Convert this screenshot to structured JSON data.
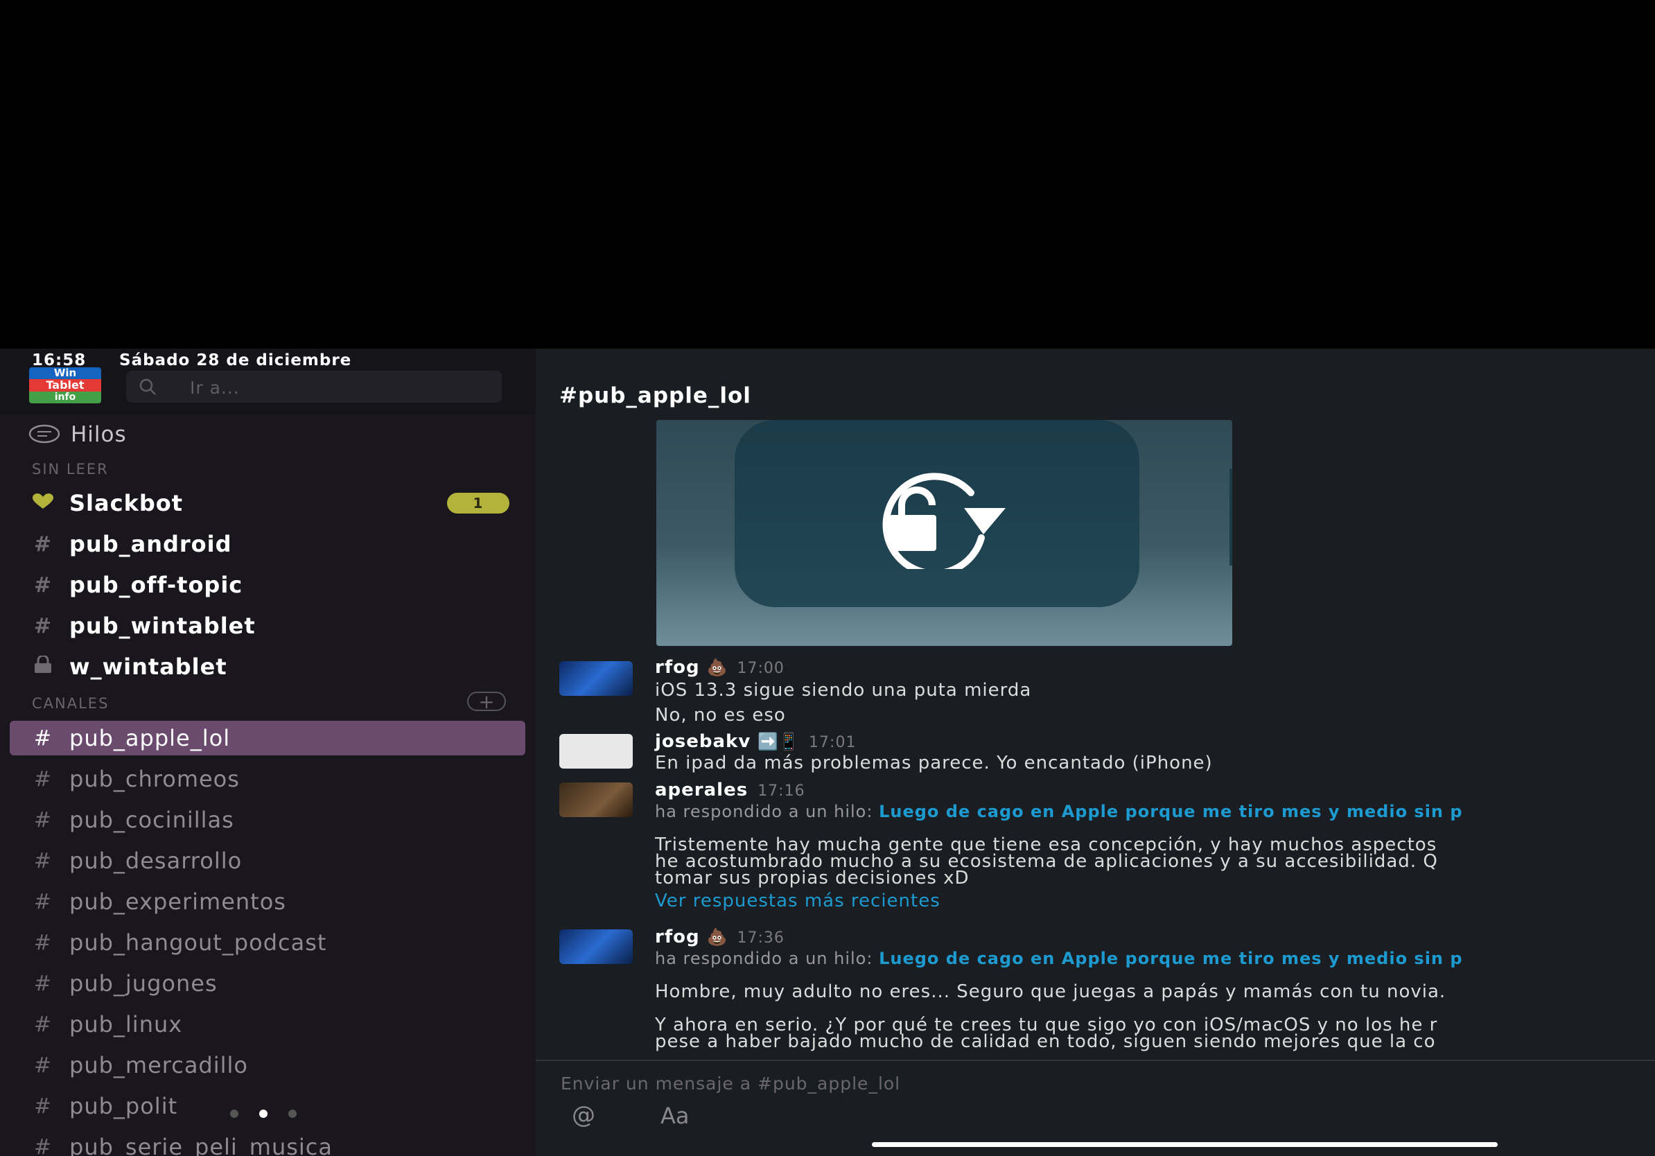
{
  "status_bar": {
    "time": "16:58",
    "date": "Sábado 28 de diciembre"
  },
  "workspace_logo": {
    "line1": "Win",
    "line2": "Tablet",
    "line3": "info"
  },
  "search": {
    "placeholder": "Ir a..."
  },
  "sidebar": {
    "threads_label": "Hilos",
    "unread_section_label": "SIN LEER",
    "unread_items": [
      {
        "name": "Slackbot",
        "prefix_icon": "heart-icon",
        "badge": "1"
      },
      {
        "name": "pub_android",
        "prefix": "#"
      },
      {
        "name": "pub_off-topic",
        "prefix": "#"
      },
      {
        "name": "pub_wintablet",
        "prefix": "#"
      },
      {
        "name": "w_wintablet",
        "prefix_icon": "lock-icon"
      }
    ],
    "channels_section_label": "CANALES",
    "channels": [
      {
        "name": "pub_apple_lol",
        "prefix": "#",
        "active": true
      },
      {
        "name": "pub_chromeos",
        "prefix": "#"
      },
      {
        "name": "pub_cocinillas",
        "prefix": "#"
      },
      {
        "name": "pub_desarrollo",
        "prefix": "#"
      },
      {
        "name": "pub_experimentos",
        "prefix": "#"
      },
      {
        "name": "pub_hangout_podcast",
        "prefix": "#"
      },
      {
        "name": "pub_jugones",
        "prefix": "#"
      },
      {
        "name": "pub_linux",
        "prefix": "#"
      },
      {
        "name": "pub_mercadillo",
        "prefix": "#"
      },
      {
        "name": "pub_polit",
        "prefix": "#"
      },
      {
        "name": "pub_serie_peli_musica",
        "prefix": "#"
      }
    ],
    "page_dots": {
      "count": 3,
      "active_index": 1
    }
  },
  "channel": {
    "title": "#pub_apple_lol"
  },
  "messages": [
    {
      "author": "rfog",
      "emoji": "💩",
      "time": "17:00",
      "lines": [
        "iOS 13.3 sigue siendo una puta mierda",
        "No, no es eso"
      ]
    },
    {
      "author": "josebakv",
      "emoji": "➡️📱",
      "time": "17:01",
      "lines": [
        "En ipad da más problemas parece. Yo encantado (iPhone)"
      ]
    },
    {
      "author": "aperales",
      "time": "17:16",
      "reply_prefix": "ha respondido a un hilo:",
      "reply_link": "Luego de cago en Apple porque me tiro mes y medio sin p",
      "lines": [
        "Tristemente hay mucha gente que tiene esa concepción, y hay muchos aspectos",
        "he acostumbrado mucho a su ecosistema de aplicaciones y a su accesibilidad. Q",
        "tomar sus propias decisiones xD"
      ],
      "more": "Ver respuestas más recientes"
    },
    {
      "author": "rfog",
      "emoji": "💩",
      "time": "17:36",
      "reply_prefix": "ha respondido a un hilo:",
      "reply_link": "Luego de cago en Apple porque me tiro mes y medio sin p",
      "lines": [
        "Hombre, muy adulto no eres... Seguro que juegas a papás y mamás con tu novia.",
        "Y ahora en serio. ¿Y por qué te crees tu que sigo yo con iOS/macOS y no los he r",
        "pese a haber bajado mucho de calidad en todo, siguen siendo mejores que la co"
      ]
    }
  ],
  "composer": {
    "placeholder": "Enviar un mensaje a #pub_apple_lol",
    "at_label": "@",
    "format_label": "Aa"
  }
}
